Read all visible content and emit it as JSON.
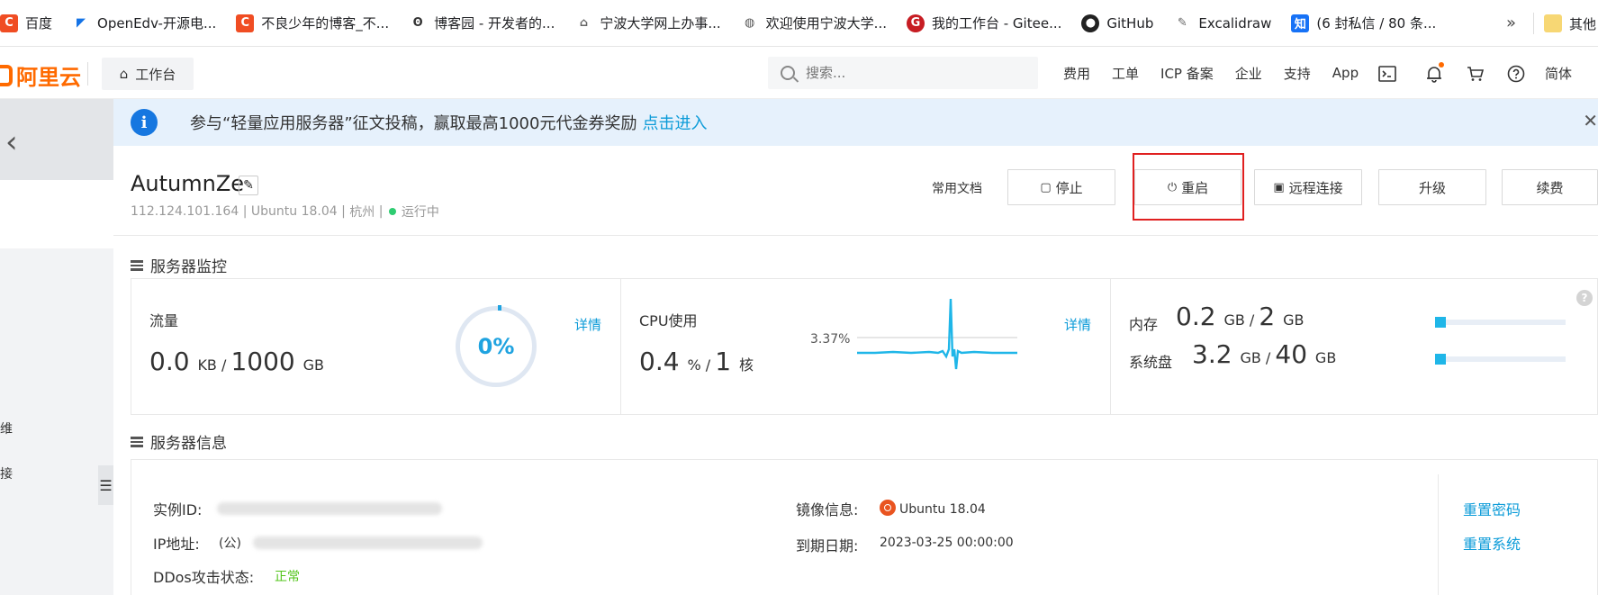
{
  "bookmarks": [
    {
      "label": "百度",
      "icon": "c-logo-icon"
    },
    {
      "label": "OpenEdv-开源电...",
      "icon": "openedv-icon"
    },
    {
      "label": "不良少年的博客_不...",
      "icon": "c-logo-icon"
    },
    {
      "label": "博客园 - 开发者的...",
      "icon": "cnblogs-icon"
    },
    {
      "label": "宁波大学网上办事...",
      "icon": "house-icon"
    },
    {
      "label": "欢迎使用宁波大学...",
      "icon": "globe-icon"
    },
    {
      "label": "我的工作台 - Gitee...",
      "icon": "gitee-icon"
    },
    {
      "label": "GitHub",
      "icon": "github-icon"
    },
    {
      "label": "Excalidraw",
      "icon": "excalidraw-icon"
    },
    {
      "label": "(6 封私信 / 80 条...",
      "icon": "zhihu-icon"
    }
  ],
  "bookmarks_more": "»",
  "bookmarks_last": "其他",
  "zhihu_glyph": "知",
  "topnav": {
    "logo": "阿里云",
    "workbench": "工作台",
    "search_placeholder": "搜索...",
    "links": [
      "费用",
      "工单",
      "ICP 备案",
      "企业",
      "支持",
      "App"
    ],
    "lang": "简体"
  },
  "banner": {
    "text": "参与“轻量应用服务器”征文投稿，赢取最高1000元代金券奖励",
    "link": "点击进入"
  },
  "sidebar": {
    "item1": "维",
    "item2": "接"
  },
  "instance": {
    "name": "AutumnZe",
    "ip": "112.124.101.164",
    "os": "Ubuntu 18.04",
    "region": "杭州",
    "status": "运行中",
    "docs": "常用文档",
    "actions": {
      "stop": "停止",
      "restart": "重启",
      "remote": "远程连接",
      "upgrade": "升级",
      "renew": "续费"
    }
  },
  "monitor": {
    "title": "服务器监控",
    "traffic": {
      "label": "流量",
      "used": "0.0",
      "used_unit": "KB",
      "total": "1000",
      "total_unit": "GB",
      "percent": "0%",
      "detail": "详情"
    },
    "cpu": {
      "label": "CPU使用",
      "used": "0.4",
      "used_unit": "%",
      "total": "1",
      "total_unit": "核",
      "peak": "3.37%",
      "detail": "详情"
    },
    "memory": {
      "label": "内存",
      "used": "0.2",
      "unit": "GB",
      "total": "2",
      "fraction": 0.1
    },
    "disk": {
      "label": "系统盘",
      "used": "3.2",
      "unit": "GB",
      "total": "40",
      "fraction": 0.08
    }
  },
  "info": {
    "title": "服务器信息",
    "instance_id_label": "实例ID:",
    "ip_label": "IP地址:",
    "ip_prefix": "(公)",
    "ddos_label": "DDos攻击状态:",
    "ddos_value": "正常",
    "image_label": "镜像信息:",
    "image_value": "Ubuntu 18.04",
    "expire_label": "到期日期:",
    "expire_value": "2023-03-25 00:00:00",
    "reset_password": "重置密码",
    "reset_system": "重置系统"
  },
  "colors": {
    "accent": "#0b9bd8",
    "brand": "#ff6a00",
    "highlight": "#e02020",
    "status_ok": "#52c41a"
  }
}
